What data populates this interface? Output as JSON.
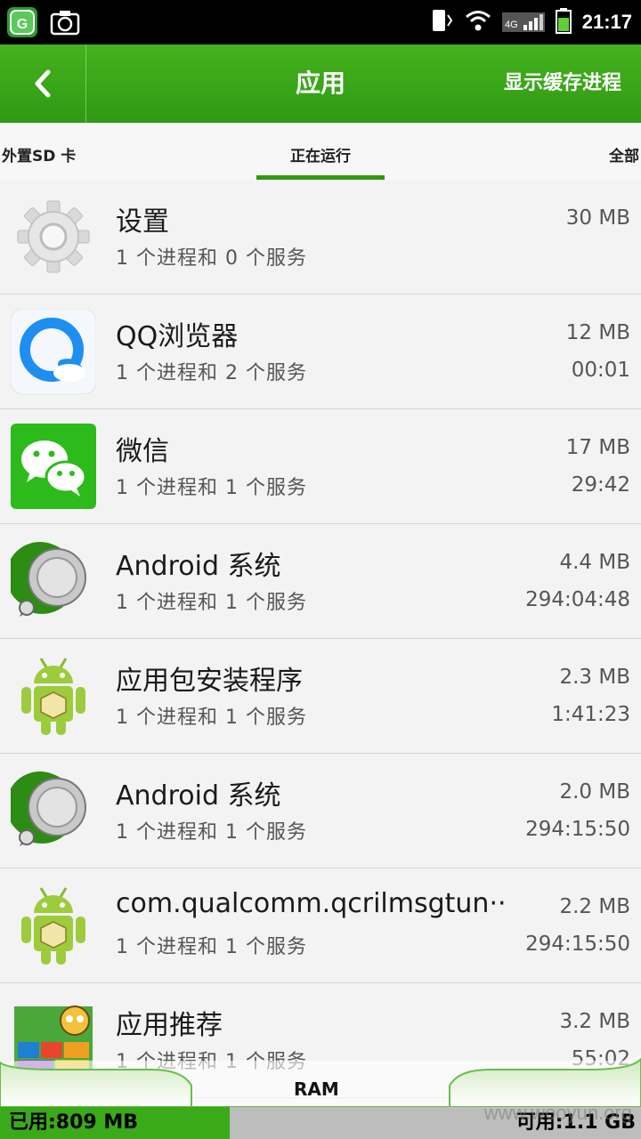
{
  "status_bar": {
    "time": "21:17",
    "network_type": "4G",
    "icons": [
      "app-shield-icon",
      "screenshot-icon",
      "vibrate-icon",
      "wifi-icon",
      "signal-icon",
      "battery-icon"
    ]
  },
  "header": {
    "title": "应用",
    "action_label": "显示缓存进程"
  },
  "tabs": {
    "left": "外置SD 卡",
    "active": "正在运行",
    "right": "全部"
  },
  "apps": [
    {
      "name": "设置",
      "processes": "1 个进程和 0 个服务",
      "memory": "30 MB",
      "time": "",
      "icon": "settings-gear-icon"
    },
    {
      "name": "QQ浏览器",
      "processes": "1 个进程和 2 个服务",
      "memory": "12 MB",
      "time": "00:01",
      "icon": "qq-browser-icon"
    },
    {
      "name": "微信",
      "processes": "1 个进程和 1 个服务",
      "memory": "17 MB",
      "time": "29:42",
      "icon": "wechat-icon"
    },
    {
      "name": "Android 系统",
      "processes": "1 个进程和 1 个服务",
      "memory": "4.4 MB",
      "time": "294:04:48",
      "icon": "android-system-icon"
    },
    {
      "name": "应用包安装程序",
      "processes": "1 个进程和 1 个服务",
      "memory": "2.3 MB",
      "time": "1:41:23",
      "icon": "android-robot-icon"
    },
    {
      "name": "Android 系统",
      "processes": "1 个进程和 1 个服务",
      "memory": "2.0 MB",
      "time": "294:15:50",
      "icon": "android-system-icon"
    },
    {
      "name": "com.qualcomm.qcrilmsgtun··",
      "processes": "1 个进程和 1 个服务",
      "memory": "2.2 MB",
      "time": "294:15:50",
      "icon": "android-robot-icon"
    },
    {
      "name": "应用推荐",
      "processes": "1 个进程和 1 个服务",
      "memory": "3.2 MB",
      "time": "55:02",
      "icon": "app-recommend-icon"
    }
  ],
  "ram": {
    "label": "RAM",
    "used": "已用:809 MB",
    "available": "可用:1.1 GB"
  },
  "watermark": "www.wooyun.org",
  "colors": {
    "accent": "#3aaa1a",
    "header": "#45b21f",
    "status_bar": "#000000",
    "list_bg": "#f3f3f3"
  }
}
